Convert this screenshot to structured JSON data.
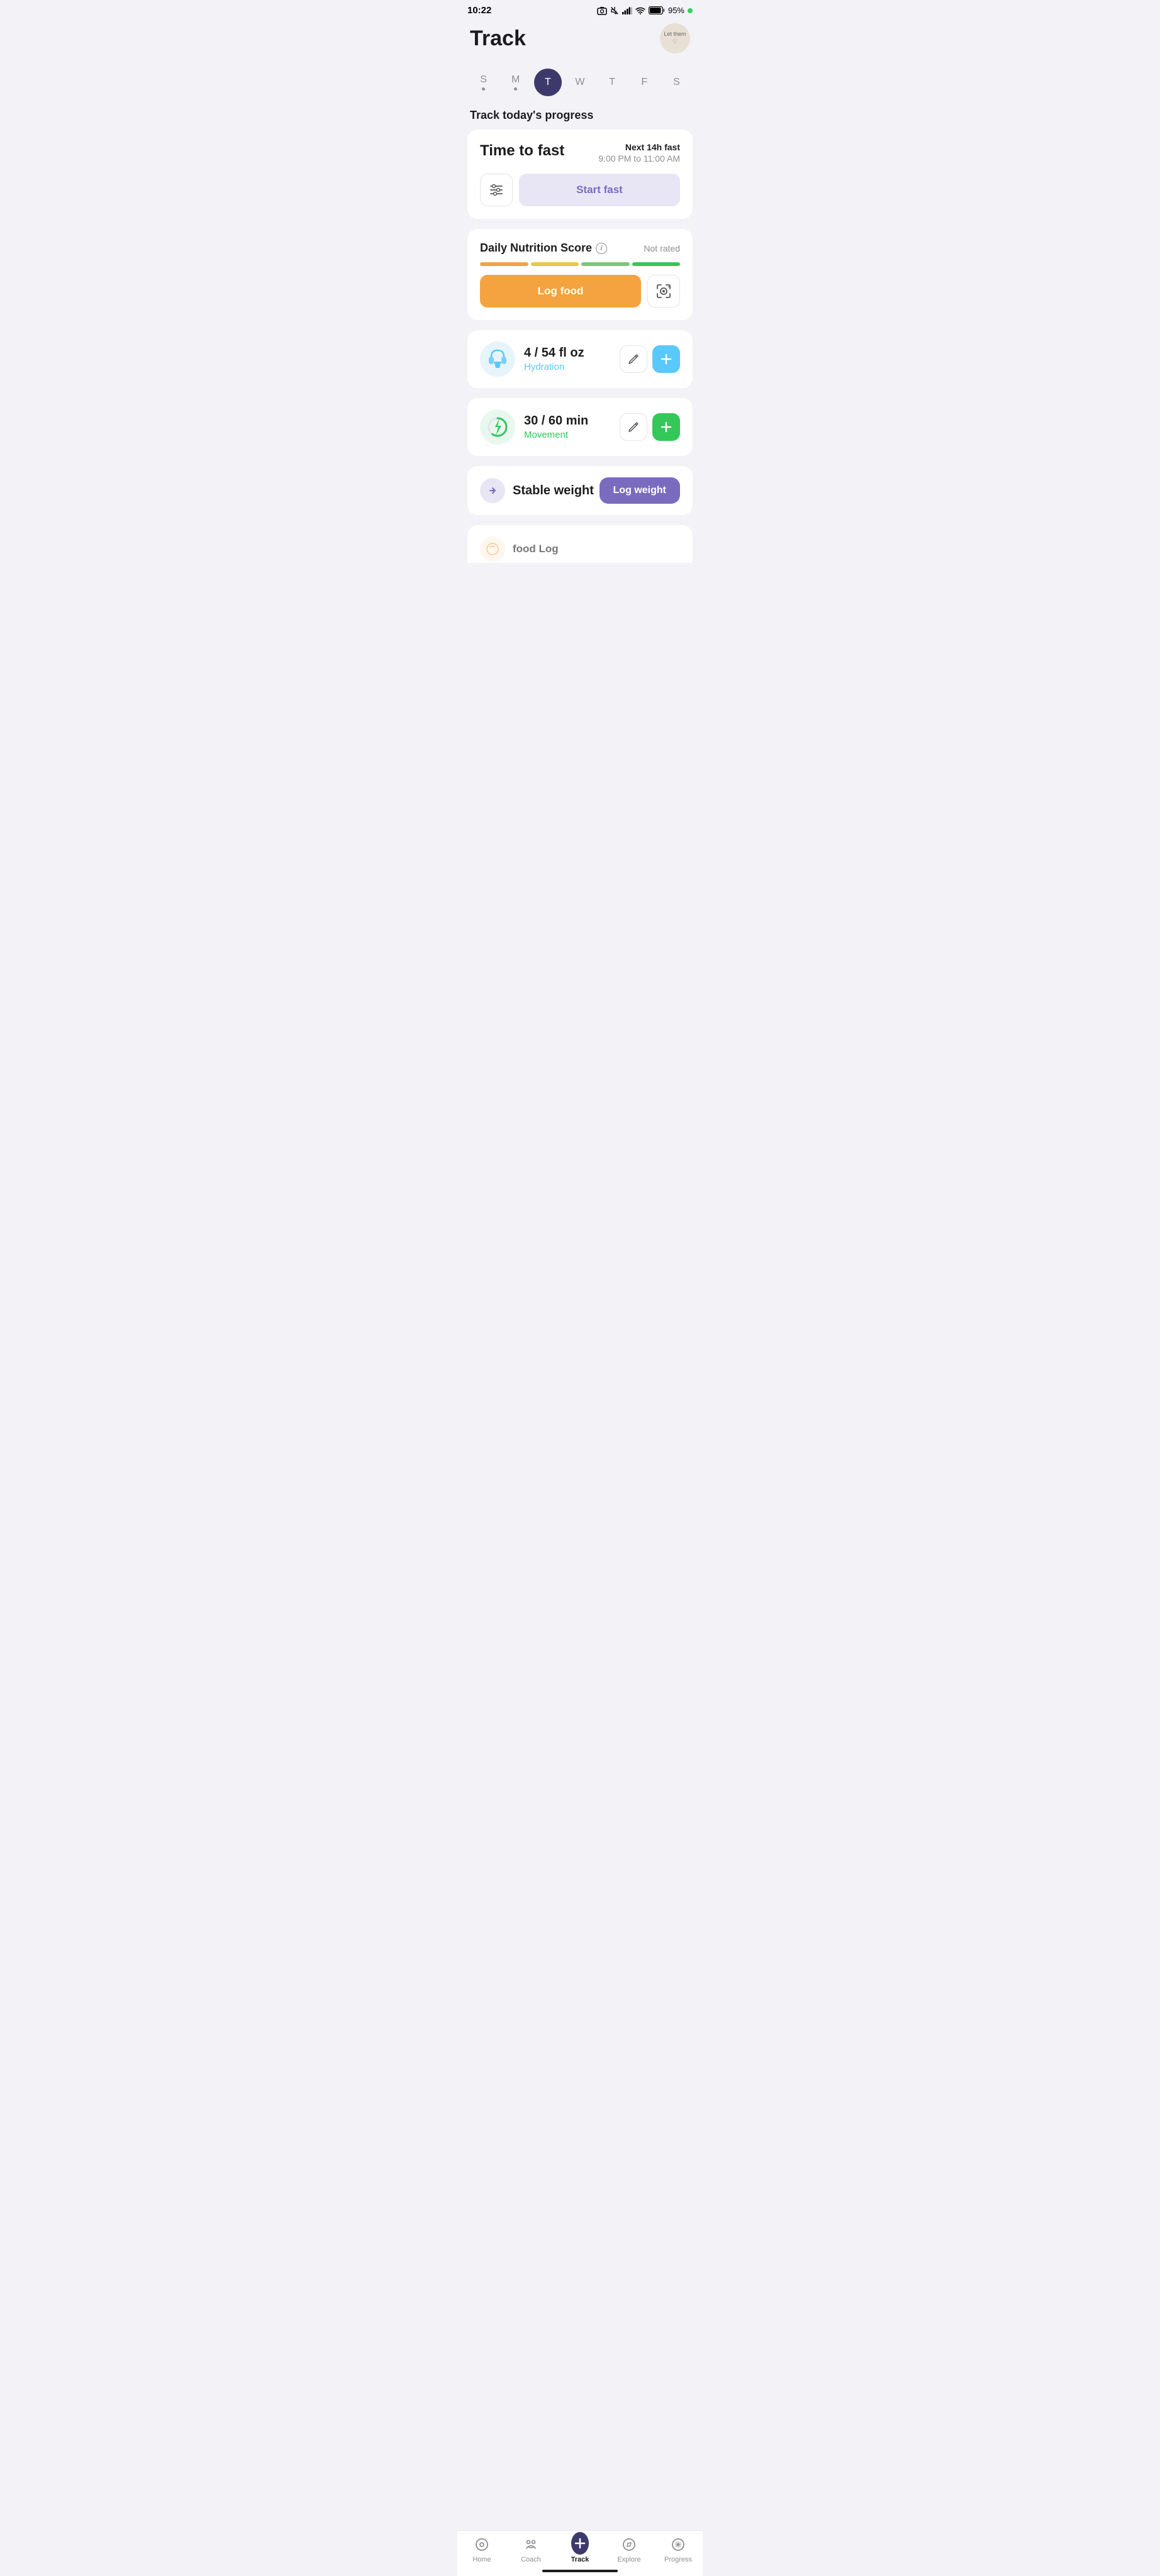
{
  "statusBar": {
    "time": "10:22",
    "battery": "95%"
  },
  "header": {
    "title": "Track",
    "avatar_label": "Let them\n♡"
  },
  "weekDays": {
    "days": [
      "S",
      "M",
      "T",
      "W",
      "T",
      "F",
      "S"
    ],
    "activeIndex": 2
  },
  "sectionTitle": "Track today's progress",
  "fastCard": {
    "title": "Time to fast",
    "nextLabel": "Next 14h fast",
    "timeRange": "9:00 PM to 11:00 AM",
    "startBtn": "Start fast"
  },
  "nutritionCard": {
    "title": "Daily Nutrition Score",
    "status": "Not rated",
    "logFoodBtn": "Log food"
  },
  "hydrationCard": {
    "value": "4 / 54 fl oz",
    "label": "Hydration"
  },
  "movementCard": {
    "value": "30 / 60 min",
    "label": "Movement"
  },
  "weightCard": {
    "label": "Stable weight",
    "logBtn": "Log weight"
  },
  "bottomNav": {
    "items": [
      {
        "label": "Home",
        "active": false
      },
      {
        "label": "Coach",
        "active": false
      },
      {
        "label": "Track",
        "active": true
      },
      {
        "label": "Explore",
        "active": false
      },
      {
        "label": "Progress",
        "active": false
      }
    ]
  }
}
